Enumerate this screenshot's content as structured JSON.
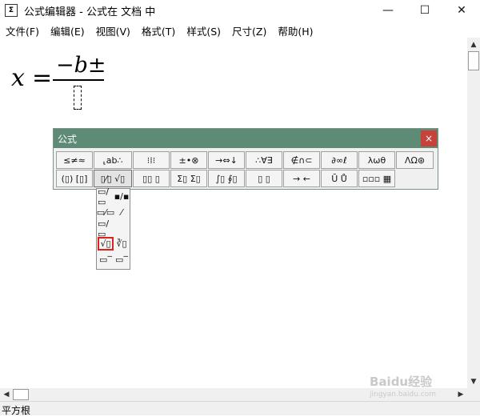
{
  "window": {
    "title": "公式编辑器 - 公式在 文档 中",
    "app_icon_glyph": "Σ",
    "minimize_glyph": "—",
    "maximize_glyph": "☐",
    "close_glyph": "✕"
  },
  "menu": {
    "items": [
      "文件(F)",
      "编辑(E)",
      "视图(V)",
      "格式(T)",
      "样式(S)",
      "尺寸(Z)",
      "帮助(H)"
    ]
  },
  "formula": {
    "variable": "x",
    "equals": "=",
    "minus": "−",
    "b": "b",
    "plus_minus": "±"
  },
  "palette": {
    "title": "公式",
    "close_glyph": "×",
    "row1": [
      "≤≠≈",
      "⸤ab∴",
      "⁝⁞⁝",
      "±•⊗",
      "→⇔↓",
      "∴∀∃",
      "∉∩⊂",
      "∂∞ℓ",
      "λωθ",
      "ΛΩ⊛"
    ],
    "row2": [
      "(▯) [▯]",
      "▯⁄▯ √▯",
      "▯▯ ▯",
      "Σ▯ Σ▯",
      "∫▯ ∮▯",
      "▯ ▯",
      "→ ←",
      "Ū Ů",
      "▫▫▫ ▦"
    ]
  },
  "dropdown": {
    "items": [
      "▭/▭",
      "▪/▪",
      "▭⁄▭",
      "⁄",
      "▭/▭",
      "",
      "√▯",
      "∛▯",
      "▭‾",
      "▭‾"
    ]
  },
  "scroll": {
    "up": "▲",
    "down": "▼",
    "left": "◀",
    "right": "▶"
  },
  "status": {
    "text": "平方根"
  },
  "watermark": {
    "logo": "Baidu经验",
    "url": "jingyan.baidu.com"
  },
  "colors": {
    "palette_title": "#5d8b76",
    "palette_close": "#c9423a",
    "selected_outline": "#e0201a"
  }
}
